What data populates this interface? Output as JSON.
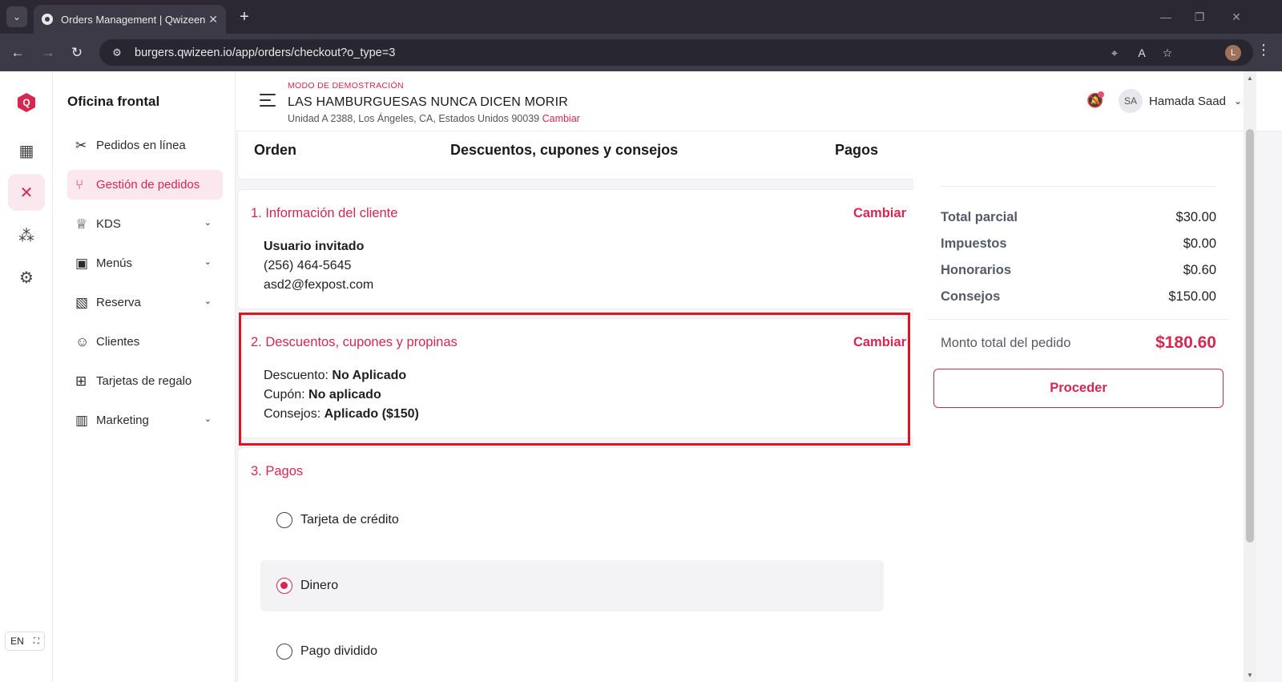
{
  "browser": {
    "tab_title": "Orders Management | Qwizeen",
    "url": "burgers.qwizeen.io/app/orders/checkout?o_type=3",
    "profile_initial": "L"
  },
  "rail": {
    "logo_letter": "Q",
    "lang_label": "EN"
  },
  "sidebar": {
    "heading": "Oficina frontal",
    "items": [
      {
        "label": "Pedidos en línea",
        "icon": "utensils-icon",
        "active": false,
        "expandable": false
      },
      {
        "label": "Gestión de pedidos",
        "icon": "fork-knife-icon",
        "active": true,
        "expandable": false
      },
      {
        "label": "KDS",
        "icon": "chef-hat-icon",
        "active": false,
        "expandable": true
      },
      {
        "label": "Menús",
        "icon": "grid-icon",
        "active": false,
        "expandable": true
      },
      {
        "label": "Reserva",
        "icon": "floor-plan-icon",
        "active": false,
        "expandable": true
      },
      {
        "label": "Clientes",
        "icon": "users-icon",
        "active": false,
        "expandable": false
      },
      {
        "label": "Tarjetas de regalo",
        "icon": "gift-icon",
        "active": false,
        "expandable": false
      },
      {
        "label": "Marketing",
        "icon": "bar-chart-icon",
        "active": false,
        "expandable": true
      }
    ]
  },
  "header": {
    "demo_label": "MODO DE DEMOSTRACIÓN",
    "restaurant": "LAS HAMBURGUESAS NUNCA DICEN MORIR",
    "address": "Unidad A 2388, Los Ángeles, CA, Estados Unidos 90039",
    "change_link": "Cambiar",
    "user_initials": "SA",
    "user_name": "Hamada Saad"
  },
  "steps": {
    "order": "Orden",
    "discounts": "Descuentos, cupones y consejos",
    "payments": "Pagos"
  },
  "customer": {
    "title": "1. Información del cliente",
    "change": "Cambiar",
    "name": "Usuario invitado",
    "phone": "(256) 464-5645",
    "email": "asd2@fexpost.com"
  },
  "discounts": {
    "title": "2. Descuentos, cupones y propinas",
    "change": "Cambiar",
    "discount_label": "Descuento:",
    "discount_value": "No Aplicado",
    "coupon_label": "Cupón:",
    "coupon_value": "No aplicado",
    "tips_label": "Consejos:",
    "tips_value": "Aplicado ($150)"
  },
  "payments": {
    "title": "3. Pagos",
    "options": [
      {
        "label": "Tarjeta de crédito",
        "selected": false
      },
      {
        "label": "Dinero",
        "selected": true
      },
      {
        "label": "Pago dividido",
        "selected": false
      }
    ]
  },
  "summary": {
    "subtotal_label": "Total parcial",
    "subtotal": "$30.00",
    "taxes_label": "Impuestos",
    "taxes": "$0.00",
    "fees_label": "Honorarios",
    "fees": "$0.60",
    "tips_label": "Consejos",
    "tips": "$150.00",
    "total_label": "Monto total del pedido",
    "total": "$180.60",
    "proceed": "Proceder"
  },
  "colors": {
    "accent": "#d62750",
    "accent_light": "#fbe8ee",
    "highlight_box": "#e0141e"
  }
}
